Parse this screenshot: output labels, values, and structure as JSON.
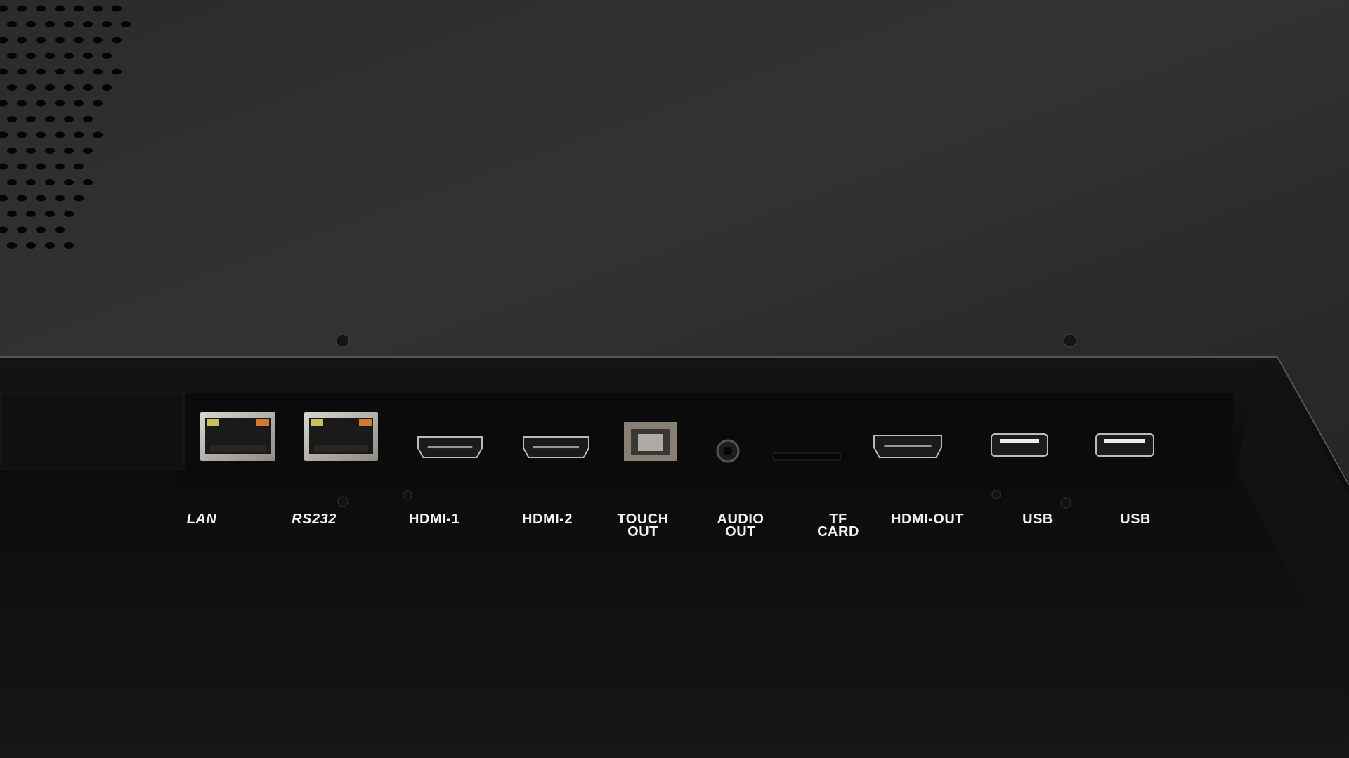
{
  "scene": {
    "subject": "device rear I/O port panel",
    "colors": {
      "chassis": "#2e2e2e",
      "panel": "#0e0e0e",
      "metal": "#b8b4ae",
      "led_green": "#c8c060",
      "led_orange": "#d07a30"
    }
  },
  "ports": [
    {
      "label": "LAN",
      "type": "rj45-icon",
      "italic": true
    },
    {
      "label": "RS232",
      "type": "rj45-icon",
      "italic": true
    },
    {
      "label": "HDMI-1",
      "type": "hdmi-icon"
    },
    {
      "label": "HDMI-2",
      "type": "hdmi-icon"
    },
    {
      "label": "TOUCH\nOUT",
      "type": "usb-b-icon"
    },
    {
      "label": "AUDIO\nOUT",
      "type": "audio-jack-icon"
    },
    {
      "label": "TF\nCARD",
      "type": "sd-slot-icon"
    },
    {
      "label": "HDMI-OUT",
      "type": "hdmi-icon"
    },
    {
      "label": "USB",
      "type": "usb-a-icon"
    },
    {
      "label": "USB",
      "type": "usb-a-icon"
    }
  ]
}
